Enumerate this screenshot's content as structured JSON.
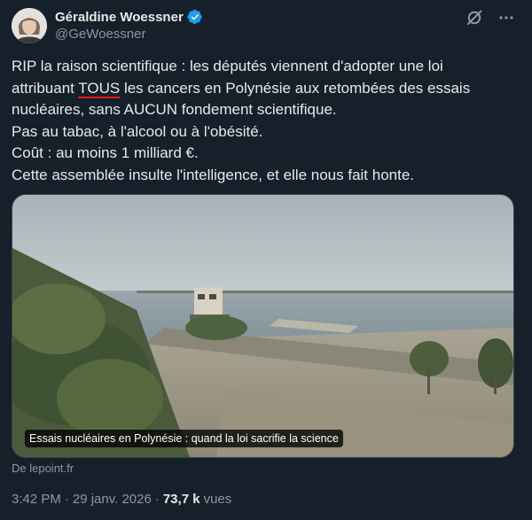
{
  "author": {
    "name": "Géraldine Woessner",
    "handle": "@GeWoessner",
    "verified": true
  },
  "tweet": {
    "line1": "RIP la raison scientifique : les députés viennent d'adopter une loi",
    "line2_pre": "attribuant ",
    "line2_emphasis": "TOUS",
    "line2_post": " les cancers en Polynésie aux retombées des essais",
    "line3": "nucléaires, sans AUCUN fondement scientifique.",
    "line4": "Pas au tabac, à l'alcool ou à l'obésité.",
    "line5": "Coût : au moins 1 milliard €.",
    "line6": "Cette assemblée insulte l'intelligence, et elle nous fait honte."
  },
  "card": {
    "caption": "Essais nucléaires en Polynésie : quand la loi sacrifie la science",
    "source": "De lepoint.fr"
  },
  "meta": {
    "time": "3:42 PM",
    "separator": "·",
    "date": "29 janv. 2026",
    "separator2": "·",
    "views_count": "73,7 k",
    "views_label": "vues"
  },
  "colors": {
    "background": "#15202b",
    "text": "#e7e9ea",
    "secondary": "#8b98a5",
    "verified": "#1d9bf0",
    "underline": "#e0201b"
  },
  "icons": {
    "verified": "verified-badge-icon",
    "grok": "grok-icon",
    "more": "more-icon"
  }
}
